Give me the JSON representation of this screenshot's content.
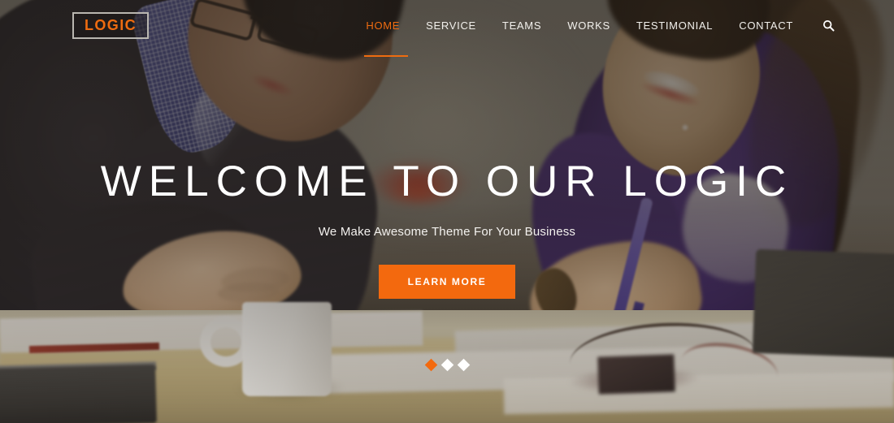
{
  "header": {
    "logo": {
      "text": "LOGIC",
      "color": "#ef6c10"
    },
    "nav_items": [
      {
        "label": "HOME",
        "active": true
      },
      {
        "label": "SERVICE",
        "active": false
      },
      {
        "label": "TEAMS",
        "active": false
      },
      {
        "label": "WORKS",
        "active": false
      },
      {
        "label": "TESTIMONIAL",
        "active": false
      },
      {
        "label": "CONTACT",
        "active": false
      }
    ],
    "search_icon": "search-icon"
  },
  "hero": {
    "title": "WELCOME TO OUR LOGIC",
    "subtitle": "We Make Awesome Theme For Your Business",
    "cta_label": "LEARN MORE",
    "accent_color": "#f3690e",
    "title_color": "#ffffff",
    "slider": {
      "total": 3,
      "active_index": 1,
      "dots": [
        {
          "index": 1,
          "active": true
        },
        {
          "index": 2,
          "active": false
        },
        {
          "index": 3,
          "active": false
        }
      ]
    }
  }
}
